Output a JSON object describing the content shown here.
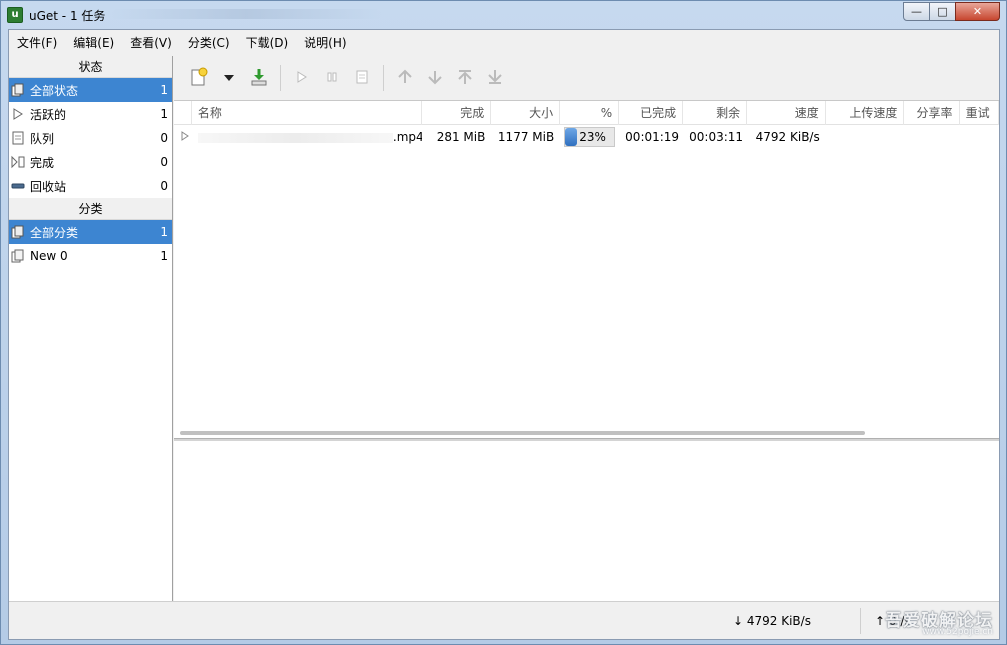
{
  "window": {
    "title": "uGet - 1 任务",
    "app_icon_letter": "u",
    "controls": {
      "minimize": "—",
      "maximize": "□",
      "close": "✕"
    }
  },
  "menu": [
    "文件(F)",
    "编辑(E)",
    "查看(V)",
    "分类(C)",
    "下载(D)",
    "说明(H)"
  ],
  "sidebar": {
    "status_header": "状态",
    "status_items": [
      {
        "label": "全部状态",
        "count": "1",
        "icon": "all-status-icon",
        "selected": true
      },
      {
        "label": "活跃的",
        "count": "1",
        "icon": "play-icon",
        "selected": false
      },
      {
        "label": "队列",
        "count": "0",
        "icon": "document-icon",
        "selected": false
      },
      {
        "label": "完成",
        "count": "0",
        "icon": "finished-icon",
        "selected": false
      },
      {
        "label": "回收站",
        "count": "0",
        "icon": "recycle-icon",
        "selected": false
      }
    ],
    "category_header": "分类",
    "category_items": [
      {
        "label": "全部分类",
        "count": "1",
        "icon": "all-category-icon",
        "selected": true
      },
      {
        "label": "New 0",
        "count": "1",
        "icon": "category-icon",
        "selected": false
      }
    ]
  },
  "toolbar": {
    "icons": [
      "new-download-icon",
      "dropdown-arrow-icon",
      "download-torrent-icon",
      "start-icon",
      "pause-icon",
      "properties-icon",
      "move-up-icon",
      "move-down-icon",
      "move-top-icon",
      "move-bottom-icon"
    ]
  },
  "list": {
    "columns": [
      "名称",
      "完成",
      "大小",
      "%",
      "已完成",
      "剩余",
      "速度",
      "上传速度",
      "分享率",
      "重试"
    ],
    "rows": [
      {
        "name_suffix": ".mp4",
        "completed": "281 MiB",
        "size": "1177 MiB",
        "percent_text": "23%",
        "percent": 23,
        "elapsed": "00:01:19",
        "remaining": "00:03:11",
        "speed": "4792 KiB/s",
        "upload_speed": "",
        "ratio": "",
        "retry": ""
      }
    ]
  },
  "statusbar": {
    "download_speed": "↓ 4792 KiB/s",
    "upload_speed": "↑ 0 /s",
    "watermark": "吾爱破解论坛",
    "watermark_url": "www.52pojie.cn"
  },
  "colors": {
    "selection": "#3d85d1",
    "progress": "#2f6fbf"
  }
}
